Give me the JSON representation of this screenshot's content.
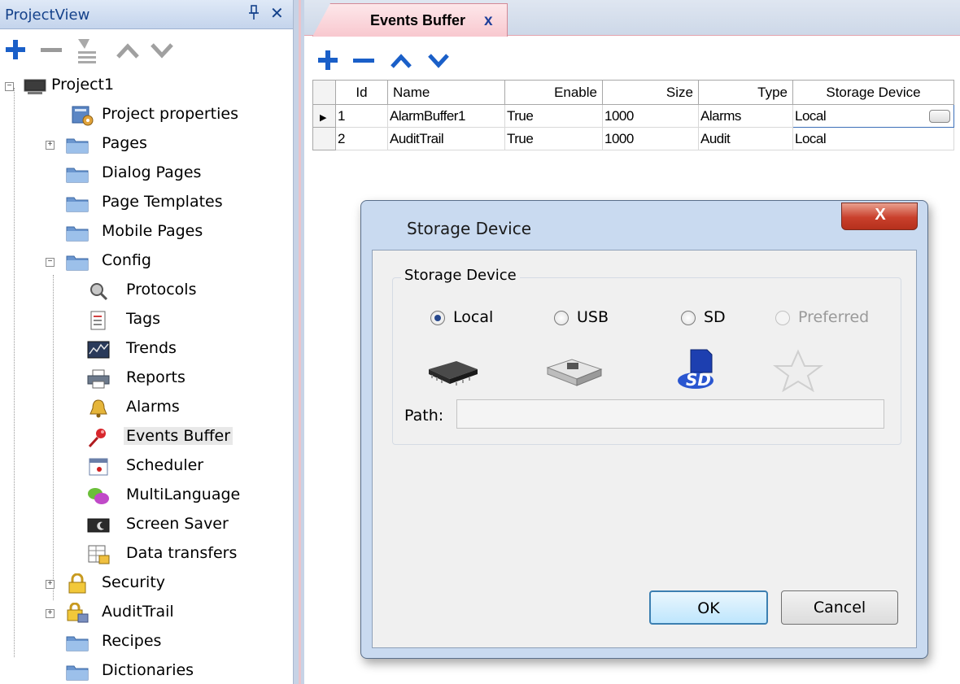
{
  "project_view": {
    "title": "ProjectView",
    "pin_icon": "pin-icon",
    "close_glyph": "✕",
    "toolbar": [
      {
        "name": "add-button",
        "icon": "plus-icon",
        "color": "#1a5fc8"
      },
      {
        "name": "remove-button",
        "icon": "minus-icon",
        "color": "#9a9a9a"
      },
      {
        "name": "properties-button",
        "icon": "properties-icon",
        "color": "#9a9a9a"
      },
      {
        "name": "move-up-button",
        "icon": "chevron-up-icon",
        "color": "#9a9a9a"
      },
      {
        "name": "move-down-button",
        "icon": "chevron-down-icon",
        "color": "#9a9a9a"
      }
    ],
    "tree": [
      {
        "label": "Project1",
        "icon": "monitor-icon",
        "level": 0,
        "expander": "minus"
      },
      {
        "label": "Project properties",
        "icon": "project-properties-icon",
        "level": 1
      },
      {
        "label": "Pages",
        "icon": "folder-icon",
        "level": 1,
        "expander": "plus"
      },
      {
        "label": "Dialog Pages",
        "icon": "folder-icon",
        "level": 1
      },
      {
        "label": "Page Templates",
        "icon": "folder-icon",
        "level": 1
      },
      {
        "label": "Mobile Pages",
        "icon": "folder-icon",
        "level": 1
      },
      {
        "label": "Config",
        "icon": "folder-icon",
        "level": 1,
        "expander": "minus"
      },
      {
        "label": "Protocols",
        "icon": "protocols-icon",
        "level": 2
      },
      {
        "label": "Tags",
        "icon": "tags-icon",
        "level": 2
      },
      {
        "label": "Trends",
        "icon": "trends-icon",
        "level": 2
      },
      {
        "label": "Reports",
        "icon": "printer-icon",
        "level": 2
      },
      {
        "label": "Alarms",
        "icon": "bell-icon",
        "level": 2
      },
      {
        "label": "Events Buffer",
        "icon": "pushpin-icon",
        "level": 2,
        "selected": true
      },
      {
        "label": "Scheduler",
        "icon": "calendar-icon",
        "level": 2
      },
      {
        "label": "MultiLanguage",
        "icon": "speech-bubbles-icon",
        "level": 2
      },
      {
        "label": "Screen Saver",
        "icon": "screen-saver-icon",
        "level": 2
      },
      {
        "label": "Data transfers",
        "icon": "data-transfer-icon",
        "level": 2
      },
      {
        "label": "Security",
        "icon": "lock-icon",
        "level": 1,
        "expander": "plus"
      },
      {
        "label": "AuditTrail",
        "icon": "audit-lock-icon",
        "level": 1,
        "expander": "plus"
      },
      {
        "label": "Recipes",
        "icon": "folder-icon",
        "level": 1
      },
      {
        "label": "Dictionaries",
        "icon": "folder-icon",
        "level": 1
      }
    ]
  },
  "editor": {
    "tab_label": "Events Buffer",
    "tab_close": "x",
    "toolbar": [
      {
        "name": "add-row-button",
        "icon": "plus-icon"
      },
      {
        "name": "remove-row-button",
        "icon": "minus-icon"
      },
      {
        "name": "row-up-button",
        "icon": "chevron-up-icon"
      },
      {
        "name": "row-down-button",
        "icon": "chevron-down-icon"
      }
    ],
    "columns": [
      "Id",
      "Name",
      "Enable",
      "Size",
      "Type",
      "Storage Device"
    ],
    "rows": [
      [
        "1",
        "AlarmBuffer1",
        "True",
        "1000",
        "Alarms",
        "Local"
      ],
      [
        "2",
        "AuditTrail",
        "True",
        "1000",
        "Audit",
        "Local"
      ]
    ]
  },
  "dialog": {
    "title": "Storage Device",
    "close_glyph": "X",
    "group_label": "Storage Device",
    "options": [
      {
        "label": "Local",
        "checked": true,
        "enabled": true,
        "icon": "chip-icon"
      },
      {
        "label": "USB",
        "checked": false,
        "enabled": true,
        "icon": "usb-drive-icon"
      },
      {
        "label": "SD",
        "checked": false,
        "enabled": true,
        "icon": "sd-card-icon"
      },
      {
        "label": "Preferred",
        "checked": false,
        "enabled": false,
        "icon": "star-icon"
      }
    ],
    "path_label": "Path:",
    "path_value": "",
    "ok_label": "OK",
    "cancel_label": "Cancel"
  },
  "colors": {
    "accent_blue": "#1a5fc8",
    "tab_pink": "#f8c8cf",
    "dialog_frame": "#c9daf0",
    "close_red": "#c9402c"
  }
}
